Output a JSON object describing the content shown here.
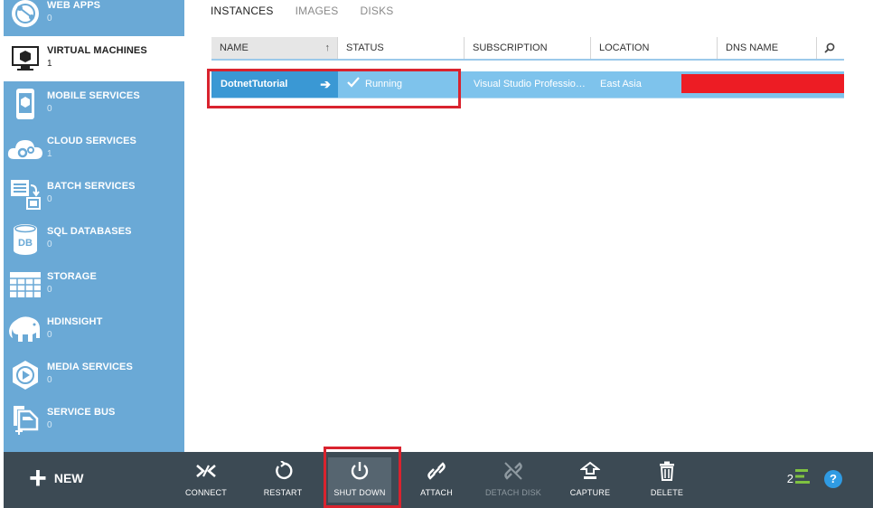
{
  "sidebar": {
    "items": [
      {
        "label": "WEB APPS",
        "count": "0",
        "icon": "web-apps-icon"
      },
      {
        "label": "VIRTUAL MACHINES",
        "count": "1",
        "icon": "virtual-machine-icon"
      },
      {
        "label": "MOBILE SERVICES",
        "count": "0",
        "icon": "mobile-services-icon"
      },
      {
        "label": "CLOUD SERVICES",
        "count": "1",
        "icon": "cloud-services-icon"
      },
      {
        "label": "BATCH SERVICES",
        "count": "0",
        "icon": "batch-services-icon"
      },
      {
        "label": "SQL DATABASES",
        "count": "0",
        "icon": "sql-database-icon"
      },
      {
        "label": "STORAGE",
        "count": "0",
        "icon": "storage-icon"
      },
      {
        "label": "HDINSIGHT",
        "count": "0",
        "icon": "hdinsight-icon"
      },
      {
        "label": "MEDIA SERVICES",
        "count": "0",
        "icon": "media-services-icon"
      },
      {
        "label": "SERVICE BUS",
        "count": "0",
        "icon": "service-bus-icon"
      }
    ]
  },
  "tabs": [
    "INSTANCES",
    "IMAGES",
    "DISKS"
  ],
  "table": {
    "headers": {
      "name": "NAME",
      "status": "STATUS",
      "subscription": "SUBSCRIPTION",
      "location": "LOCATION",
      "dns": "DNS NAME"
    },
    "rows": [
      {
        "name": "DotnetTutorial",
        "status": "Running",
        "subscription": "Visual Studio Professiona...",
        "location": "East Asia"
      }
    ]
  },
  "commandbar": {
    "new_label": "NEW",
    "commands": [
      {
        "label": "CONNECT",
        "icon": "connect-icon"
      },
      {
        "label": "RESTART",
        "icon": "restart-icon"
      },
      {
        "label": "SHUT DOWN",
        "icon": "power-icon"
      },
      {
        "label": "ATTACH",
        "icon": "attach-icon"
      },
      {
        "label": "DETACH DISK",
        "icon": "detach-disk-icon"
      },
      {
        "label": "CAPTURE",
        "icon": "capture-icon"
      },
      {
        "label": "DELETE",
        "icon": "delete-icon"
      }
    ],
    "notification_count": "2",
    "help_label": "?"
  },
  "colors": {
    "sidebar_bg": "#6aa9d6",
    "selected_row": "#7ec3ec",
    "selected_name_cell": "#3a98d4",
    "commandbar_bg": "#3c4a54",
    "highlight_box": "#d9232e"
  }
}
